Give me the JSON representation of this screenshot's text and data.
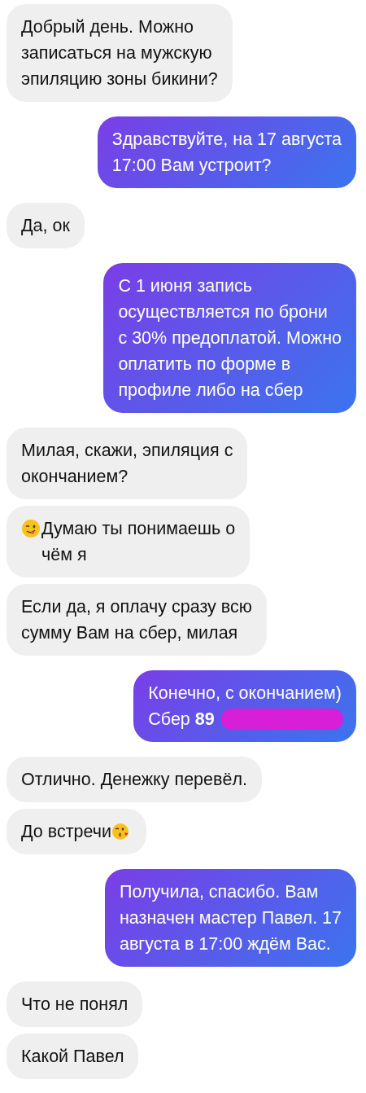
{
  "messages": [
    {
      "sent": false,
      "text": "Добрый день. Можно\nзаписаться на мужскую\nэпиляцию зоны бикини?"
    },
    {
      "sent": true,
      "text": "Здравствуйте, на 17 августа\n17:00 Вам устроит?"
    },
    {
      "sent": false,
      "text": "Да, ок"
    },
    {
      "sent": true,
      "text": "С 1 июня запись\nосуществляется по брони\nс 30% предоплатой. Можно\nоплатить по форме в\nпрофиле либо на сбер"
    },
    {
      "sent": false,
      "text": "Милая, скажи, эпиляция с\nокончанием?"
    },
    {
      "sent": false,
      "text": "Думаю ты понимаешь о\nчём я",
      "leading_icon": true
    },
    {
      "sent": false,
      "text": "Если да, я оплачу сразу всю\nсумму Вам на сбер, милая"
    },
    {
      "sent": true,
      "text": "Конечно, с окончанием)\nСбер **89**",
      "redacted": true
    },
    {
      "sent": false,
      "text": "Отлично. Денежку перевёл."
    },
    {
      "sent": false,
      "text": "До встречи",
      "trailing_icon": true
    },
    {
      "sent": true,
      "text": "Получила, спасибо. Вам\nназначен мастер Павел. 17\nавгуста в 17:00 ждём Вас."
    },
    {
      "sent": false,
      "text": "Что не понял"
    },
    {
      "sent": false,
      "text": "Какой Павел"
    }
  ]
}
